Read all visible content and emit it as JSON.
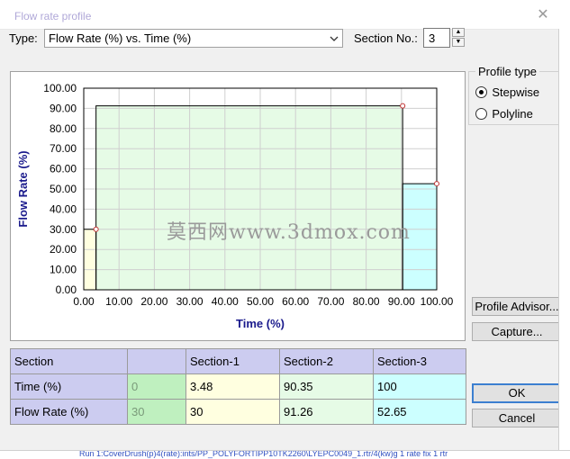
{
  "window": {
    "title": "Flow rate profile"
  },
  "type_label": "Type:",
  "type_select_value": "Flow Rate (%) vs. Time (%)",
  "section_no_label": "Section No.:",
  "section_no_value": "3",
  "profile_type": {
    "legend": "Profile type",
    "options": [
      "Stepwise",
      "Polyline"
    ],
    "selected": "Stepwise"
  },
  "buttons": {
    "profile_advisor": "Profile Advisor...",
    "capture": "Capture...",
    "ok": "OK",
    "cancel": "Cancel"
  },
  "chart_data": {
    "type": "area",
    "xlabel": "Time (%)",
    "ylabel": "Flow Rate (%)",
    "xlim": [
      0,
      100
    ],
    "ylim": [
      0,
      100
    ],
    "xticks": [
      "0.00",
      "10.00",
      "20.00",
      "30.00",
      "40.00",
      "50.00",
      "60.00",
      "70.00",
      "80.00",
      "90.00",
      "100.00"
    ],
    "yticks": [
      "0.00",
      "10.00",
      "20.00",
      "30.00",
      "40.00",
      "50.00",
      "60.00",
      "70.00",
      "80.00",
      "90.00",
      "100.00"
    ],
    "grid": true,
    "step": "stepwise",
    "sections": [
      {
        "start": 0,
        "end": 3.48,
        "value": 30,
        "color": "#ffffe0"
      },
      {
        "start": 3.48,
        "end": 90.35,
        "value": 91.26,
        "color": "#e6fbe6"
      },
      {
        "start": 90.35,
        "end": 100,
        "value": 52.65,
        "color": "#ccffff"
      }
    ],
    "points": [
      {
        "x": 3.48,
        "y": 30
      },
      {
        "x": 90.35,
        "y": 91.26
      },
      {
        "x": 100,
        "y": 52.65
      }
    ]
  },
  "table": {
    "header": [
      "Section",
      "",
      "Section-1",
      "Section-2",
      "Section-3"
    ],
    "rows": [
      {
        "label": "Time (%)",
        "cells": [
          "0",
          "3.48",
          "90.35",
          "100"
        ]
      },
      {
        "label": "Flow Rate (%)",
        "cells": [
          "30",
          "30",
          "91.26",
          "52.65"
        ]
      }
    ]
  },
  "watermark": "莫西网www.3dmox.com",
  "status_url": "Run 1:CoverDrush(p)4(rate):ints/PP_POLYFORTIPP10TK2260\\LYEPC0049_1.rtr/4(kw)g 1 rate fix 1 rtr"
}
